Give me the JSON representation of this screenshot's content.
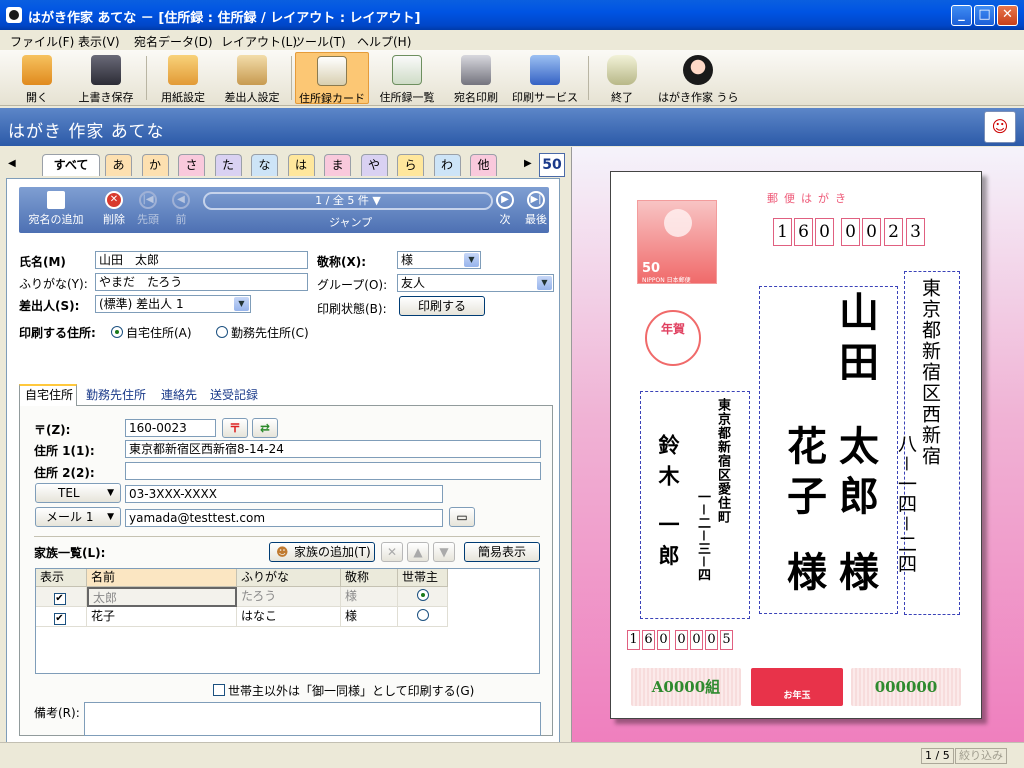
{
  "window": {
    "title": "はがき作家 あてな － [住所録 : 住所録 / レイアウト : レイアウト]",
    "min": "_",
    "max": "□",
    "close": "✕"
  },
  "menu": [
    "ファイル(F)",
    "表示(V)",
    "宛名データ(D)",
    "レイアウト(L)",
    "ツール(T)",
    "ヘルプ(H)"
  ],
  "toolbar": [
    {
      "label": "開く",
      "icon": "open-folder-icon",
      "color": "#f1a83a"
    },
    {
      "label": "上書き保存",
      "icon": "floppy-disk-icon",
      "color": "#4a4a58"
    },
    {
      "label": "用紙設定",
      "icon": "paper-setup-icon",
      "color": "#e9b04a"
    },
    {
      "label": "差出人設定",
      "icon": "sender-setup-icon",
      "color": "#d9b86a"
    },
    {
      "label": "住所録カード",
      "icon": "address-card-icon",
      "color": "#f4e9c8"
    },
    {
      "label": "住所録一覧",
      "icon": "address-list-icon",
      "color": "#7db06b"
    },
    {
      "label": "宛名印刷",
      "icon": "printer-icon",
      "color": "#8c8c95"
    },
    {
      "label": "印刷サービス",
      "icon": "print-service-icon",
      "color": "#4d7fd4"
    },
    {
      "label": "終了",
      "icon": "exit-icon",
      "color": "#c9c9a0"
    },
    {
      "label": "はがき作家 うら",
      "icon": "hagaki-ura-icon",
      "color": "#2a2a2a"
    }
  ],
  "banner": {
    "title": "はがき 作家 あてな"
  },
  "index_tabs": {
    "all": "すべて",
    "kana": [
      {
        "label": "あ",
        "color": "#fde0b0"
      },
      {
        "label": "か",
        "color": "#fde0b0"
      },
      {
        "label": "さ",
        "color": "#f9c9dc"
      },
      {
        "label": "た",
        "color": "#d9d1f2"
      },
      {
        "label": "な",
        "color": "#cde4f7"
      },
      {
        "label": "は",
        "color": "#ffe79c"
      },
      {
        "label": "ま",
        "color": "#f9c9dc"
      },
      {
        "label": "や",
        "color": "#d9d1f2"
      },
      {
        "label": "ら",
        "color": "#ffe79c"
      },
      {
        "label": "わ",
        "color": "#cde4f7"
      },
      {
        "label": "他",
        "color": "#f9c9dc"
      }
    ],
    "count": "50"
  },
  "recnav": {
    "add": "宛名の追加",
    "delete": "削除",
    "first": "先頭",
    "prev": "前",
    "position": "1 / 全 5 件 ▼",
    "jump": "ジャンプ",
    "next": "次",
    "last": "最後"
  },
  "form": {
    "name_label": "氏名(M)",
    "name_value": "山田　太郎",
    "kana_label": "ふりがな(Y):",
    "kana_value": "やまだ　たろう",
    "sender_label": "差出人(S):",
    "sender_value": "(標準) 差出人 1",
    "title_label": "敬称(X):",
    "title_value": "様",
    "group_label": "グループ(O):",
    "group_value": "友人",
    "printstate_label": "印刷状態(B):",
    "printstate_btn": "印刷する",
    "printaddr_label": "印刷する住所:",
    "radio_home": "自宅住所(A)",
    "radio_work": "勤務先住所(C)"
  },
  "tabs": [
    "自宅住所",
    "勤務先住所",
    "連絡先",
    "送受記録"
  ],
  "address": {
    "zip_label": "〒(Z):",
    "zip_value": "160-0023",
    "addr1_label": "住所 1(1):",
    "addr1_value": "東京都新宿区西新宿8-14-24",
    "addr2_label": "住所 2(2):",
    "addr2_value": "",
    "tel_label": "TEL",
    "tel_value": "03-3XXX-XXXX",
    "mail_label": "メール 1",
    "mail_value": "yamada@testtest.com"
  },
  "family": {
    "label": "家族一覧(L):",
    "add_btn": "家族の追加(T)",
    "simple_btn": "簡易表示",
    "headers": [
      "表示",
      "名前",
      "ふりがな",
      "敬称",
      "世帯主"
    ],
    "rows": [
      {
        "show": true,
        "name": "太郎",
        "kana": "たろう",
        "title": "様",
        "head": true
      },
      {
        "show": true,
        "name": "花子",
        "kana": "はなこ",
        "title": "様",
        "head": false
      }
    ],
    "print_option": "世帯主以外は「御一同様」として印刷する(G)"
  },
  "notes_label": "備考(R):",
  "postcard": {
    "header": "郵便はがき",
    "zip_digits": [
      "1",
      "6",
      "0",
      "0",
      "0",
      "2",
      "3"
    ],
    "stamp_value": "50",
    "stamp_brand": "NIPPON 日本郵便",
    "seal": "年賀",
    "recipient_address": "東京都新宿区西新宿",
    "recipient_number": "八－一四－二四",
    "recipient_name1": "山田",
    "recipient_given1": "太郎",
    "recipient_given2": "花子",
    "honorific": "様",
    "sender_address": "東京都新宿区愛住町",
    "sender_number": "一－二－三－四",
    "sender_name": "鈴木 一郎",
    "sender_zip": [
      "1",
      "6",
      "0",
      "0",
      "0",
      "0",
      "5"
    ],
    "lottery_group": "A0000組",
    "lottery_number": "000000",
    "lottery_logo": "お年玉"
  },
  "status": {
    "page": "1 / 5",
    "filter": "絞り込み"
  }
}
